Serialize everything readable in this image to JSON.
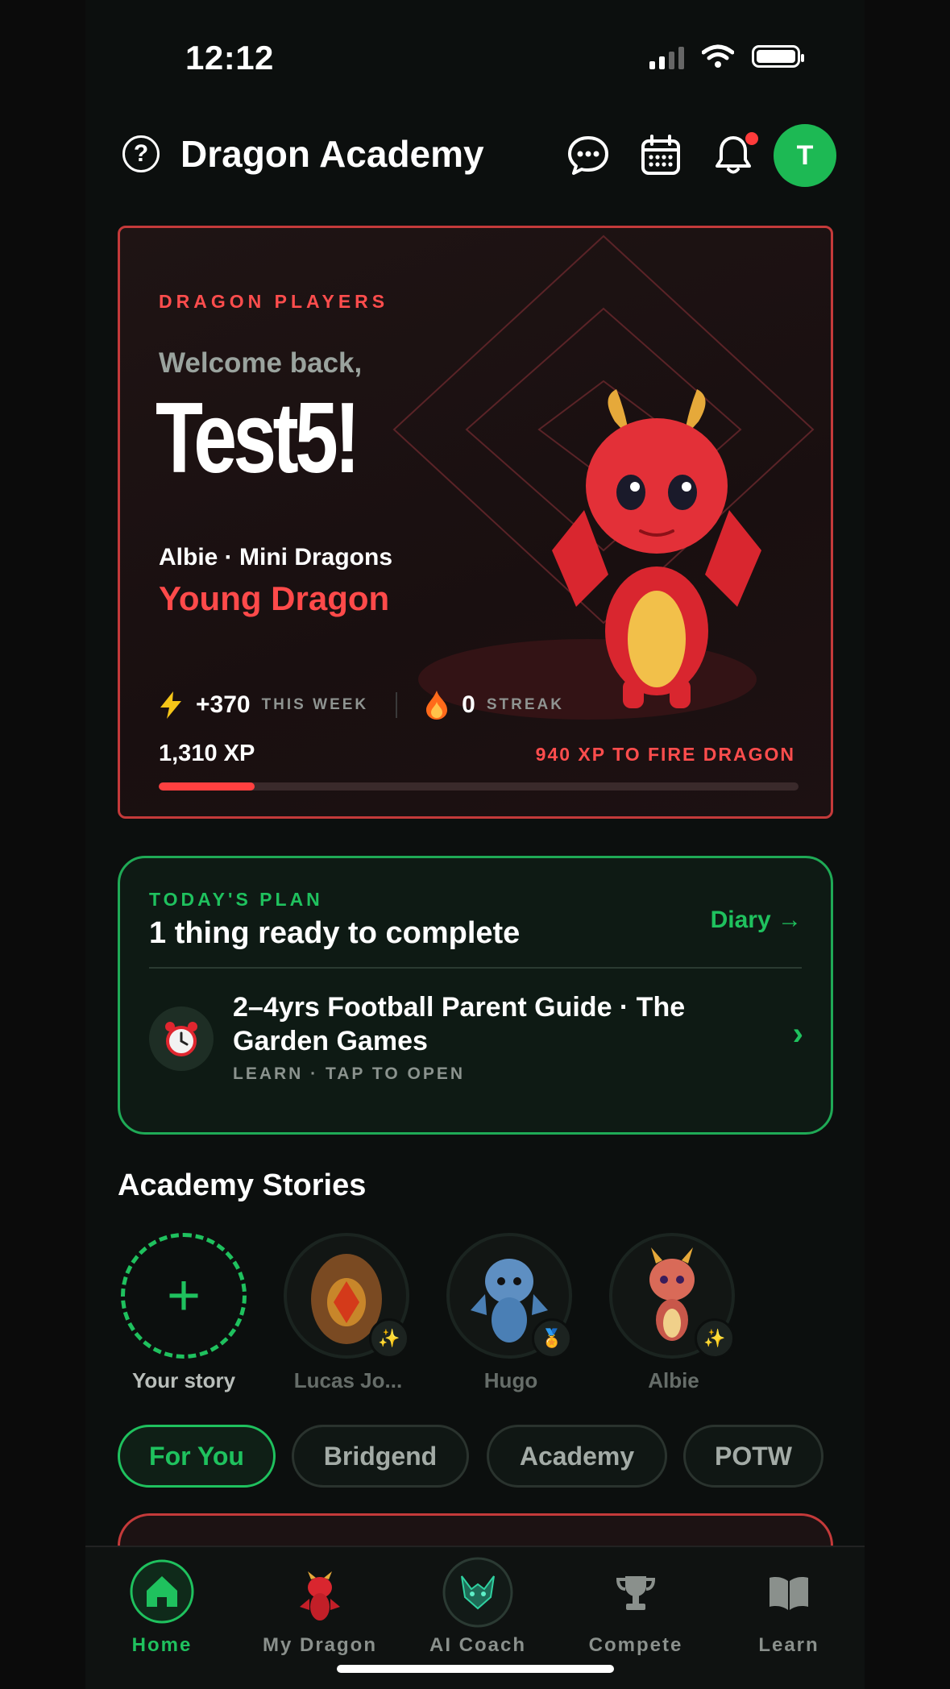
{
  "status_bar": {
    "time": "12:12"
  },
  "header": {
    "title": "Dragon Academy",
    "help_icon": "question-circle-icon",
    "avatar_initial": "T"
  },
  "hero": {
    "tag": "DRAGON PLAYERS",
    "welcome": "Welcome back,",
    "name": "Test5!",
    "subtitle": "Albie · Mini Dragons",
    "rank": "Young Dragon",
    "weekly_xp": "+370",
    "weekly_label": "THIS WEEK",
    "streak": "0",
    "streak_label": "STREAK",
    "xp_total": "1,310 XP",
    "xp_to_next": "940 XP TO FIRE DRAGON",
    "progress_fraction": 0.15,
    "accent": "#ff4a4a"
  },
  "plan": {
    "tag": "TODAY'S PLAN",
    "title": "1 thing ready to complete",
    "diary": "Diary →",
    "item_title": "2–4yrs Football Parent Guide · The Garden Games",
    "item_meta": "LEARN · TAP TO OPEN",
    "accent": "#1fc15e"
  },
  "stories": {
    "title": "Academy Stories",
    "items": [
      {
        "label": "Your story"
      },
      {
        "label": "Lucas Jo..."
      },
      {
        "label": "Hugo"
      },
      {
        "label": "Albie"
      }
    ]
  },
  "chips": [
    "For You",
    "Bridgend",
    "Academy",
    "POTW"
  ],
  "tabs": [
    {
      "label": "Home"
    },
    {
      "label": "My Dragon"
    },
    {
      "label": "AI Coach"
    },
    {
      "label": "Compete"
    },
    {
      "label": "Learn"
    }
  ]
}
